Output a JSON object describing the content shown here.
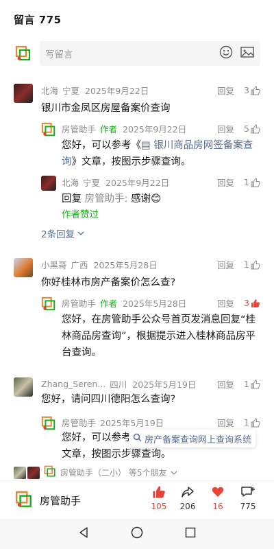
{
  "header": {
    "title": "留言 775"
  },
  "write": {
    "placeholder": "写留言"
  },
  "comments": [
    {
      "name": "北海",
      "location": "宁夏",
      "date": "2025年9月22日",
      "reply_label": "回复",
      "likes": "3",
      "text": "银川市金凤区房屋备案价查询"
    },
    {
      "name": "房管助手",
      "author_tag": "作者",
      "date": "2025年9月22日",
      "reply_label": "回复",
      "likes": "5",
      "text_pre": "您好，可以参考《",
      "link": "银川商品房网签备案查询",
      "text_post": "》文章，按图示步骤查询。"
    },
    {
      "name": "北海",
      "location": "宁夏",
      "date": "2025年9月22日",
      "reply_label": "回复",
      "likes": "1",
      "text_pre": "回复 ",
      "mention": "房管助手:",
      "text_post": " 感谢😊",
      "author_liked": "作者赞过"
    },
    {
      "name": "小黑哥",
      "location": "广西",
      "date": "2025年5月28日",
      "reply_label": "回复",
      "likes": "1",
      "text": "你好桂林市房产备案价怎么查?"
    },
    {
      "name": "房管助手",
      "author_tag": "作者",
      "date": "2025年5月28日",
      "reply_label": "回复",
      "likes": "3",
      "text": "您好，在房管助手公众号首页发消息回复“桂林商品房查询”，根据提示进入桂林商品房平台查询。"
    },
    {
      "name": "Zhang_Seren...",
      "location": "四川",
      "date": "2025年5月19日",
      "reply_label": "回复",
      "likes": "1",
      "text": "您好，请问四川德阳怎么查询?"
    },
    {
      "name": "房管助手",
      "date": "2025年5月19日",
      "reply_label": "回复",
      "likes": "1",
      "text": "您好，可以参考《",
      "text2": "文章，按图示步骤查询。"
    }
  ],
  "more_replies": "2条回复",
  "search_popup": {
    "text": "房产备案查询网上查询系统"
  },
  "friends": {
    "text": "房管助手（二小） 等5个朋友"
  },
  "bottom": {
    "account_name": "房管助手",
    "likes": "105",
    "shares": "206",
    "hearts": "16",
    "comments": "775"
  },
  "colors": {
    "accent_green": "#1aad19",
    "link_blue": "#576b95",
    "like_red": "#e8443a"
  }
}
